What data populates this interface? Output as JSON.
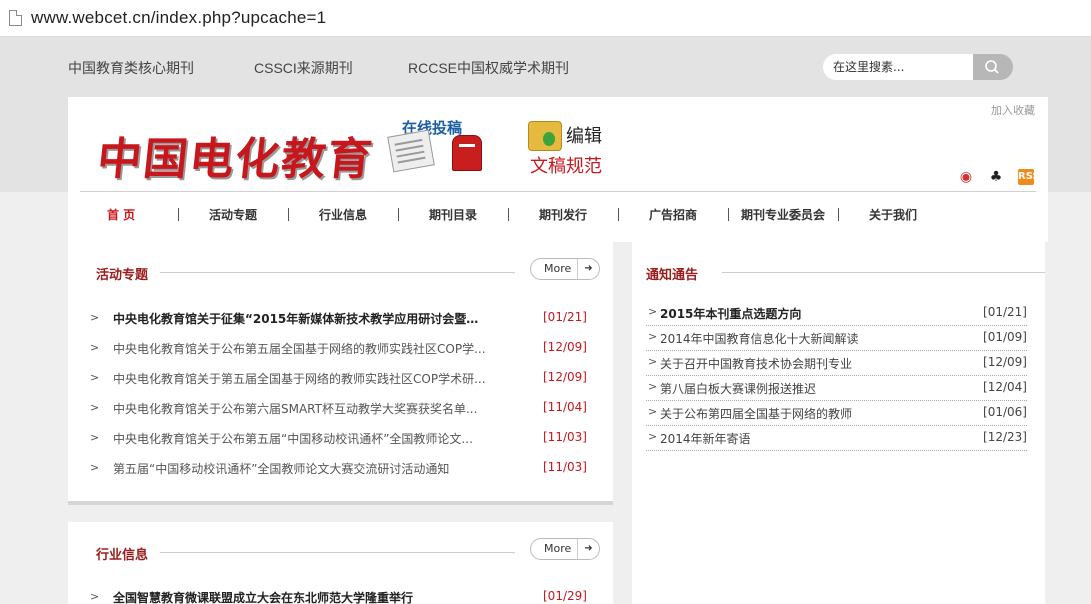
{
  "browser": {
    "url": "www.webcet.cn/index.php?upcache=1"
  },
  "toplinks": [
    "中国教育类核心期刊",
    "CSSCI来源期刊",
    "RCCSE中国权威学术期刊"
  ],
  "search": {
    "placeholder": "在这里搜素..."
  },
  "header": {
    "favorite": "加入收藏",
    "logo_text": "中国电化教育",
    "submit_label": "在线投稿",
    "edit_label": "编辑",
    "guide_label": "文稿规范"
  },
  "nav": [
    "首 页",
    "活动专题",
    "行业信息",
    "期刊目录",
    "期刊发行",
    "广告招商",
    "期刊专业委员会",
    "关于我们"
  ],
  "activities": {
    "title": "活动专题",
    "more": "More",
    "items": [
      {
        "title": "中央电化教育馆关于征集“2015年新媒体新技术教学应用研讨会暨第...",
        "date": "[01/21]"
      },
      {
        "title": "中央电化教育馆关于公布第五届全国基于网络的教师实践社区COP学...",
        "date": "[12/09]"
      },
      {
        "title": "中央电化教育馆关于第五届全国基于网络的教师实践社区COP学术研...",
        "date": "[12/09]"
      },
      {
        "title": "中央电化教育馆关于公布第六届SMART杯互动教学大奖赛获奖名单...",
        "date": "[11/04]"
      },
      {
        "title": "中央电化教育馆关于公布第五届“中国移动校讯通杯”全国教师论文...",
        "date": "[11/03]"
      },
      {
        "title": "第五届“中国移动校讯通杯”全国教师论文大赛交流研讨活动通知",
        "date": "[11/03]"
      }
    ]
  },
  "industry": {
    "title": "行业信息",
    "more": "More",
    "items": [
      {
        "title": "全国智慧教育微课联盟成立大会在东北师范大学隆重举行",
        "date": "[01/29]"
      }
    ]
  },
  "notices": {
    "title": "通知通告",
    "items": [
      {
        "title": "2015年本刊重点选题方向",
        "date": "[01/21]"
      },
      {
        "title": "2014年中国教育信息化十大新闻解读",
        "date": "[01/09]"
      },
      {
        "title": "关于召开中国教育技术协会期刊专业",
        "date": "[12/09]"
      },
      {
        "title": "第八届白板大赛课例报送推迟",
        "date": "[12/04]"
      },
      {
        "title": "关于公布第四届全国基于网络的教师",
        "date": "[01/06]"
      },
      {
        "title": "2014年新年寄语",
        "date": "[12/23]"
      }
    ]
  },
  "icons": {
    "bullet": ">",
    "arrow": "➜",
    "weibo": "◉",
    "qq": "♣",
    "rss": "RSS"
  },
  "colors": {
    "brand_red": "#c8161d",
    "section_title": "#9a1c1c",
    "submit_blue": "#1d5fa4"
  }
}
